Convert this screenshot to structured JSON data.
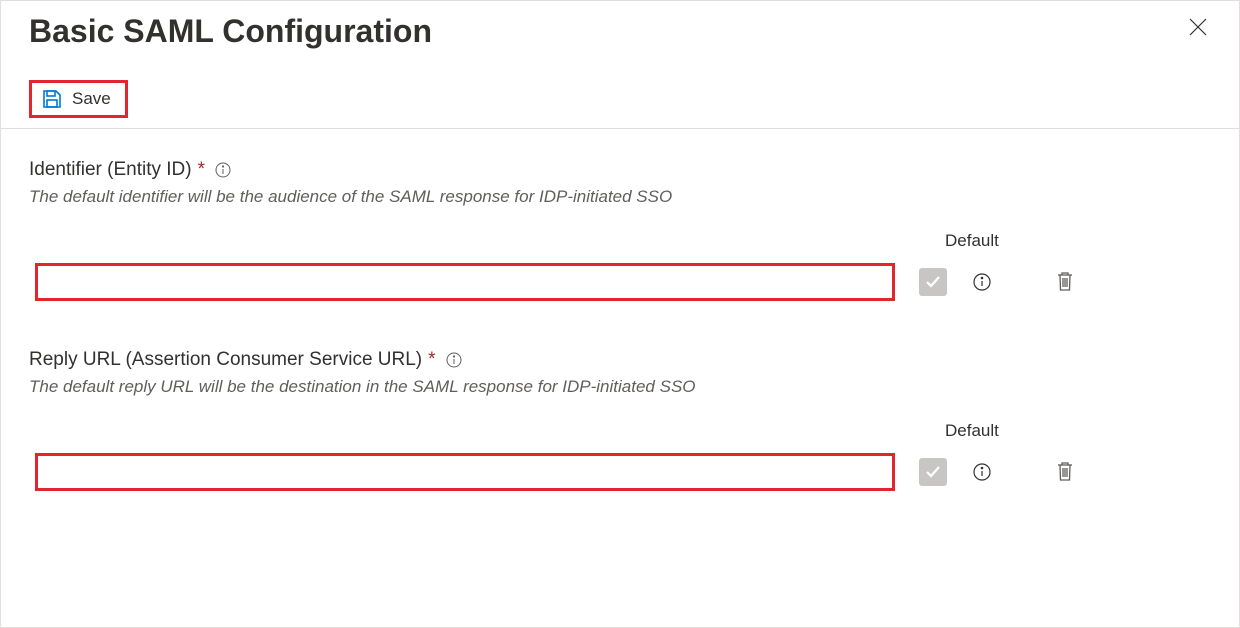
{
  "header": {
    "title": "Basic SAML Configuration"
  },
  "toolbar": {
    "save_label": "Save"
  },
  "sections": {
    "identifier": {
      "label": "Identifier (Entity ID)",
      "description": "The default identifier will be the audience of the SAML response for IDP-initiated SSO",
      "default_header": "Default",
      "input_value": ""
    },
    "reply_url": {
      "label": "Reply URL (Assertion Consumer Service URL)",
      "description": "The default reply URL will be the destination in the SAML response for IDP-initiated SSO",
      "default_header": "Default",
      "input_value": ""
    }
  }
}
